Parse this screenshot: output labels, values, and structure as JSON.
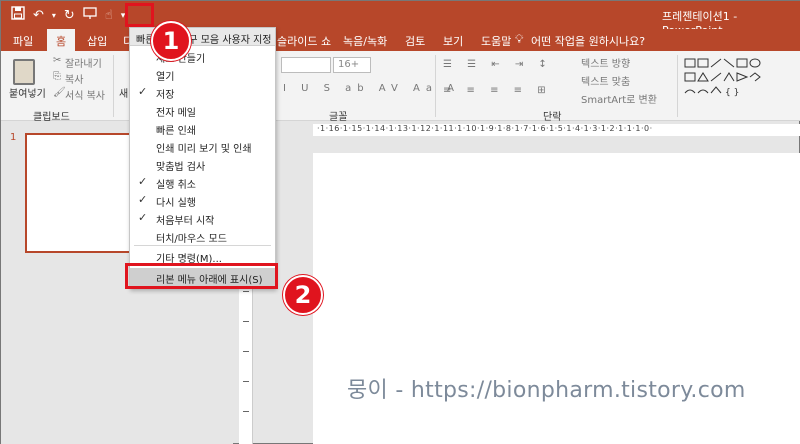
{
  "window": {
    "title": "프레젠테이션1 - PowerPoint"
  },
  "qat": {
    "save_icon": "floppy-icon",
    "undo_icon": "undo-icon",
    "redo_icon": "redo-icon",
    "customize_icon": "dropdown-icon"
  },
  "tabs": [
    "파일",
    "홈",
    "삽입",
    "디",
    "슬라이드 쇼",
    "녹음/녹화",
    "검토",
    "보기",
    "도움말"
  ],
  "tellme": "어떤 작업을 원하시나요?",
  "ribbon": {
    "paste": "붙여넣기",
    "cut": "잘라내기",
    "copy": "복사",
    "format_painter": "서식 복사",
    "clipboard_group": "클립보드",
    "new_slide_short": "새",
    "font_size": "16+",
    "font_group": "글꼴",
    "para_group": "단락",
    "text_direction": "텍스트 방향",
    "text_align": "텍스트 맞춤",
    "smartart": "SmartArt로 변환"
  },
  "menu": {
    "header": "빠른 실행 도구 모음 사용자 지정",
    "items": [
      {
        "label": "새로 만들기",
        "checked": false
      },
      {
        "label": "열기",
        "checked": false
      },
      {
        "label": "저장",
        "checked": true
      },
      {
        "label": "전자 메일",
        "checked": false
      },
      {
        "label": "빠른 인쇄",
        "checked": false
      },
      {
        "label": "인쇄 미리 보기 및 인쇄",
        "checked": false
      },
      {
        "label": "맞춤법 검사",
        "checked": false
      },
      {
        "label": "실행 취소",
        "checked": true
      },
      {
        "label": "다시 실행",
        "checked": true
      },
      {
        "label": "처음부터 시작",
        "checked": true
      },
      {
        "label": "터치/마우스 모드",
        "checked": false
      }
    ],
    "more_commands": "기타 명령(M)...",
    "show_below": "리본 메뉴 아래에 표시(S)"
  },
  "check_glyph": "✓",
  "thumbnail": {
    "slide_number": "1"
  },
  "ruler": {
    "h_text": "·1·16·1·15·1·14·1·13·1·12·1·11·1·10·1·9·1·8·1·7·1·6·1·5·1·4·1·3·1·2·1·1·1·0·"
  },
  "callouts": {
    "step1": "1",
    "step2": "2"
  },
  "watermark": "뭉이 - https://bionpharm.tistory.com",
  "colors": {
    "accent": "#b7472a",
    "callout": "#e0141e"
  }
}
